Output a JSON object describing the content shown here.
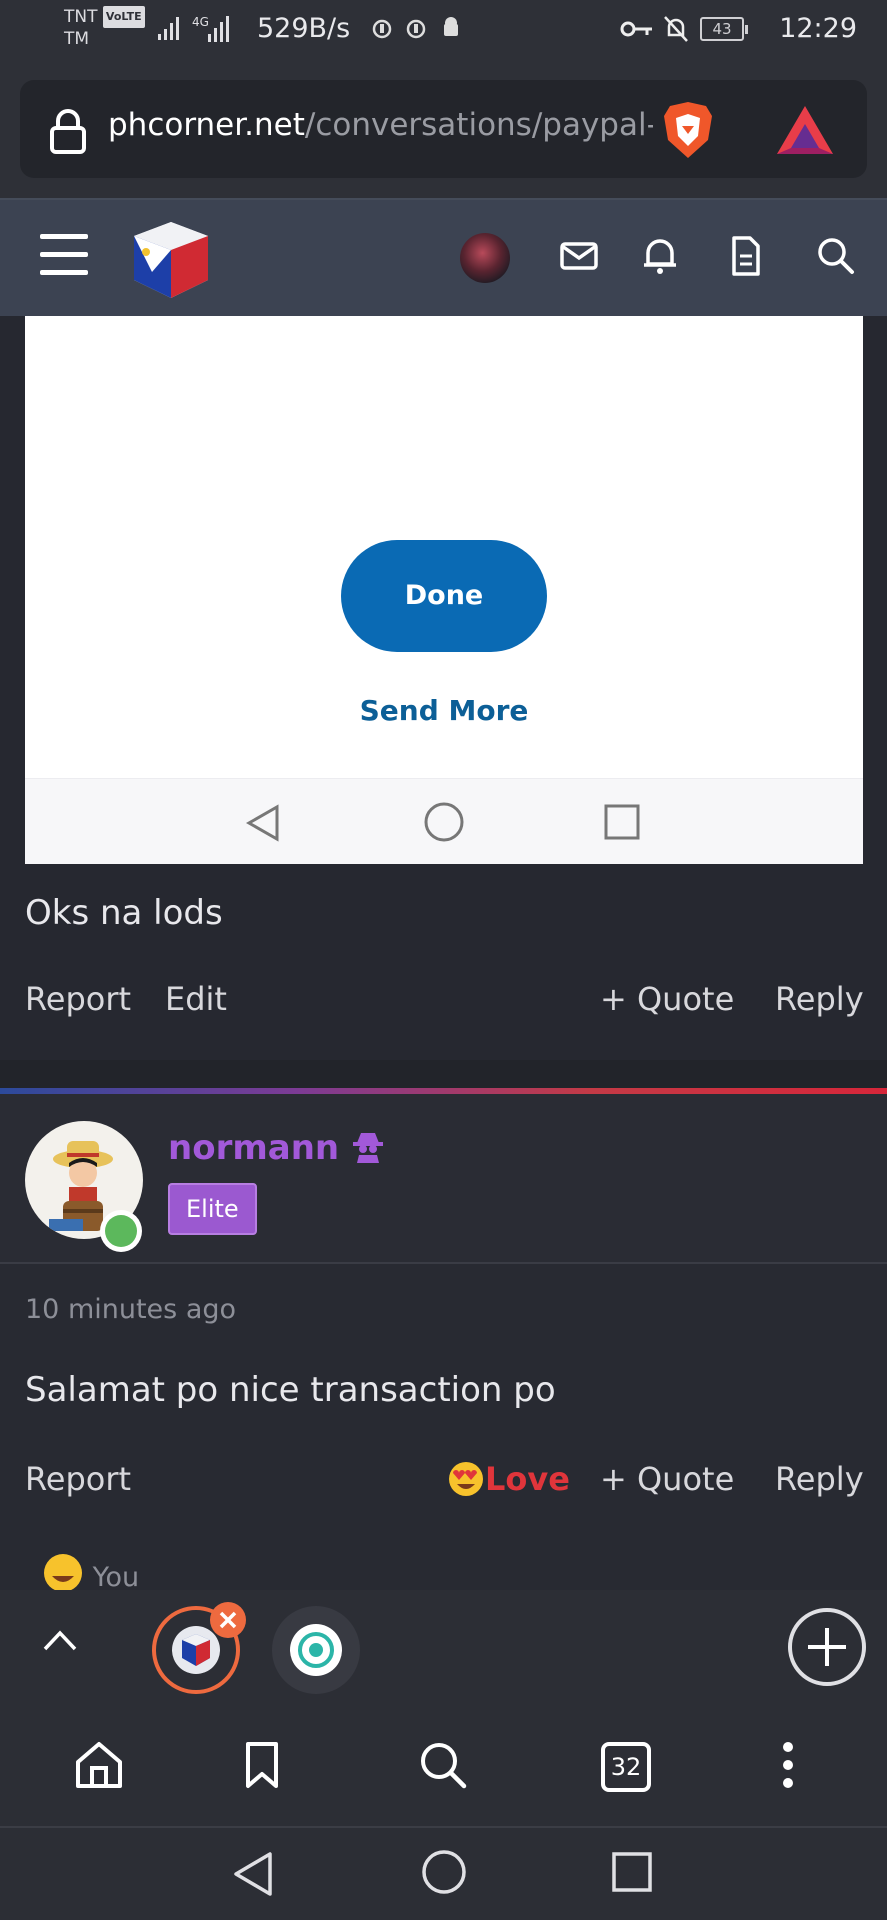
{
  "status_bar": {
    "carrier_top": "TNT",
    "volte": "VoLTE",
    "carrier_bottom": "TM",
    "network": "4G",
    "net_speed": "529B/s",
    "battery": "43",
    "time": "12:29"
  },
  "browser": {
    "url_host": "phcorner.net",
    "url_path": "/conversations/paypal-t",
    "tab_count": "32"
  },
  "screenshot_embed": {
    "done_label": "Done",
    "send_more_label": "Send More"
  },
  "post1": {
    "message": "Oks na lods",
    "actions": {
      "report": "Report",
      "edit": "Edit",
      "quote": "+ Quote",
      "reply": "Reply"
    }
  },
  "post2": {
    "username": "normann",
    "badge": "Elite",
    "timestamp": "10 minutes ago",
    "message": "Salamat po nice transaction po",
    "actions": {
      "report": "Report",
      "love": "Love",
      "quote": "+ Quote",
      "reply": "Reply"
    },
    "reaction_by": "You"
  },
  "colors": {
    "username": "#a259d9",
    "badge": "#9b59d0",
    "love": "#e0353b",
    "done_button": "#0a6ab4",
    "header": "#3c4352"
  }
}
